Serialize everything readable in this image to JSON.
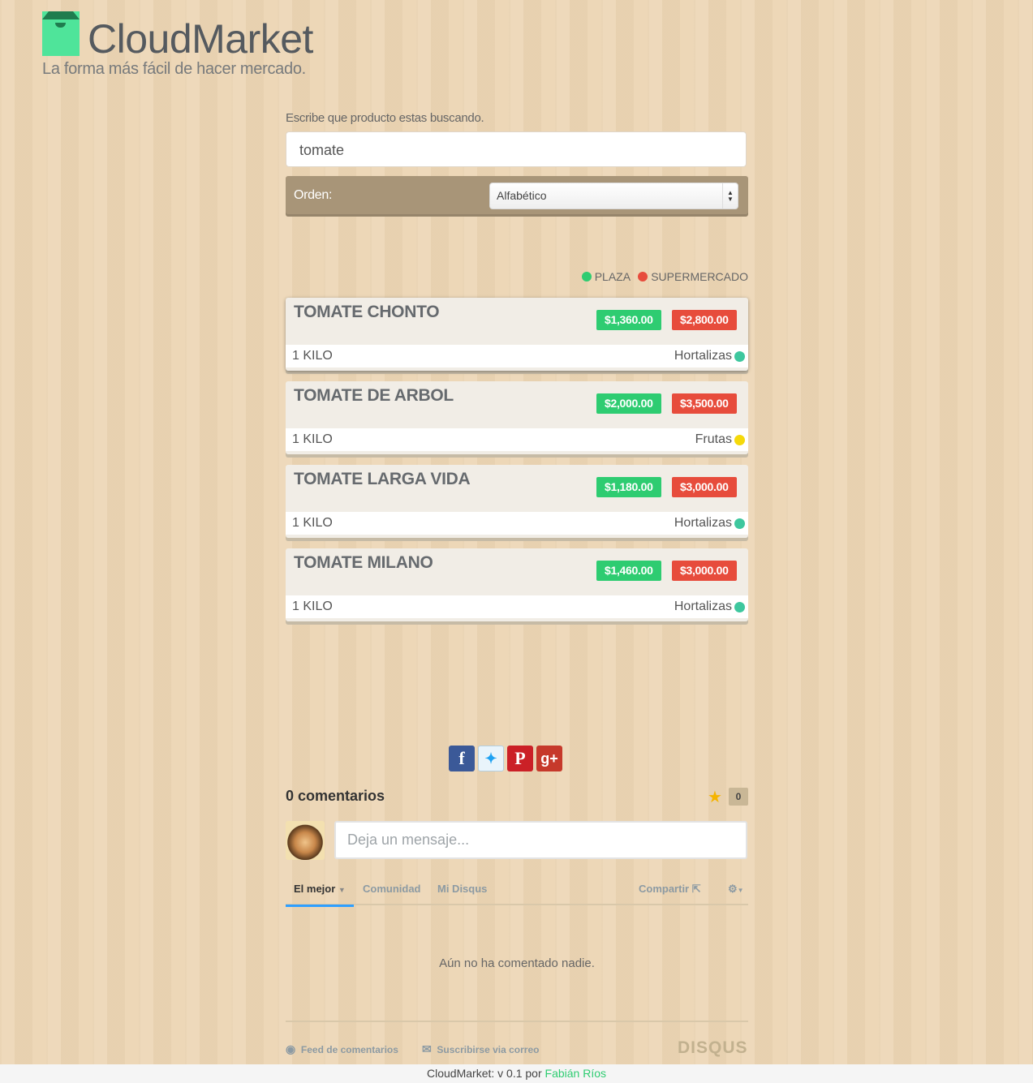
{
  "header": {
    "brand": "CloudMarket",
    "tagline": "La forma más fácil de hacer mercado."
  },
  "search": {
    "label": "Escribe que producto estas buscando.",
    "value": "tomate"
  },
  "order": {
    "label": "Orden:",
    "selected": "Alfabético"
  },
  "legend": {
    "plaza": "PLAZA",
    "supermercado": "SUPERMERCADO",
    "plaza_color": "#2ecc71",
    "super_color": "#e74c3c"
  },
  "products": [
    {
      "name": "TOMATE CHONTO",
      "plaza_price": "$1,360.00",
      "super_price": "$2,800.00",
      "unit": "1 KILO",
      "category": "Hortalizas",
      "category_color": "#3ec79e"
    },
    {
      "name": "TOMATE DE ARBOL",
      "plaza_price": "$2,000.00",
      "super_price": "$3,500.00",
      "unit": "1 KILO",
      "category": "Frutas",
      "category_color": "#f5d90a"
    },
    {
      "name": "TOMATE LARGA VIDA",
      "plaza_price": "$1,180.00",
      "super_price": "$3,000.00",
      "unit": "1 KILO",
      "category": "Hortalizas",
      "category_color": "#3ec79e"
    },
    {
      "name": "TOMATE MILANO",
      "plaza_price": "$1,460.00",
      "super_price": "$3,000.00",
      "unit": "1 KILO",
      "category": "Hortalizas",
      "category_color": "#3ec79e"
    }
  ],
  "share": {
    "icons": [
      "facebook-icon",
      "twitter-icon",
      "pinterest-icon",
      "google-plus-icon"
    ]
  },
  "comments": {
    "title": "0 comentarios",
    "star_count": "0",
    "placeholder": "Deja un mensaje...",
    "tabs": {
      "best": "El mejor",
      "community": "Comunidad",
      "my_disqus": "Mi Disqus",
      "share": "Compartir"
    },
    "empty": "Aún no ha comentado nadie.",
    "feed": "Feed de comentarios",
    "subscribe": "Suscribirse via correo",
    "disqus": "DISQUS"
  },
  "footer": {
    "text": "CloudMarket: v 0.1 por",
    "author": "Fabián Ríos"
  }
}
